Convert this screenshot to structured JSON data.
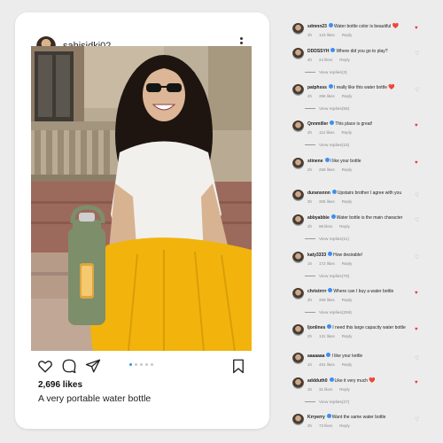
{
  "post": {
    "username": "sahjsidkj02",
    "likes": "2,696 likes",
    "caption": "A very portable water bottle",
    "carousel_total": 5,
    "carousel_active": 1
  },
  "comments": [
    {
      "user": "sdmnn23",
      "text": "Water bottle color is beautiful",
      "emoji": "❤️",
      "time": "3h",
      "likes": "123 likes",
      "reply": "Reply",
      "liked": true
    },
    {
      "user": "DDDSSYH",
      "text": "Where did you go to play?",
      "emoji": "",
      "time": "4h",
      "likes": "24 likes",
      "reply": "Reply",
      "liked": false,
      "view_replies": "View replies(3)"
    },
    {
      "user": "patphsss",
      "text": "I really like this water bottle",
      "emoji": "❤️",
      "time": "4h",
      "likes": "286 likes",
      "reply": "Reply",
      "liked": false,
      "view_replies": "View replies(58)"
    },
    {
      "user": "Qnnmiller",
      "text": "This place is great!",
      "emoji": "",
      "time": "3h",
      "likes": "112 likes",
      "reply": "Reply",
      "liked": true,
      "view_replies": "View replies(15)"
    },
    {
      "user": "stinene",
      "text": "I like your bottle",
      "emoji": "",
      "time": "2h",
      "likes": "258 likes",
      "reply": "Reply",
      "liked": true
    },
    {
      "user": "duransnnn",
      "text": "Upstairs brother I agree with you",
      "emoji": "",
      "time": "3h",
      "likes": "305 likes",
      "reply": "Reply",
      "liked": false
    },
    {
      "user": "abbyabbie",
      "text": "Water bottle is the main character",
      "emoji": "",
      "time": "3h",
      "likes": "98 likes",
      "reply": "Reply",
      "liked": false,
      "view_replies": "View replies(11)"
    },
    {
      "user": "katy3333",
      "text": "How desirable!",
      "emoji": "",
      "time": "1h",
      "likes": "172 likes",
      "reply": "Reply",
      "liked": false,
      "view_replies": "View replies(79)"
    },
    {
      "user": "christrrrr",
      "text": "Where can I buy a water bottle",
      "emoji": "",
      "time": "3h",
      "likes": "269 likes",
      "reply": "Reply",
      "liked": true,
      "view_replies": "View replies(259)"
    },
    {
      "user": "ljonlines",
      "text": "I need this large capacity water bottle",
      "emoji": "",
      "time": "2h",
      "likes": "131 likes",
      "reply": "Reply",
      "liked": true
    },
    {
      "user": "aaaaaaa",
      "text": "I like your kettle",
      "emoji": "",
      "time": "1h",
      "likes": "491 likes",
      "reply": "Reply",
      "liked": false
    },
    {
      "user": "addduth0",
      "text": "Like it very much",
      "emoji": "❤️",
      "time": "1h",
      "likes": "31 likes",
      "reply": "Reply",
      "liked": true,
      "view_replies": "View replies(27)"
    },
    {
      "user": "Krryerry",
      "text": "Want the same water bottle",
      "emoji": "",
      "time": "3h",
      "likes": "73 likes",
      "reply": "Reply",
      "liked": false
    }
  ],
  "colors": {
    "accent": "#3d8ef0",
    "heart": "#e0363c",
    "bottle": "#7d8e6a",
    "skirt": "#f2b40c"
  },
  "icons": [
    "more-vertical-icon",
    "heart-icon",
    "comment-icon",
    "share-icon",
    "bookmark-icon",
    "verified-badge-icon"
  ]
}
